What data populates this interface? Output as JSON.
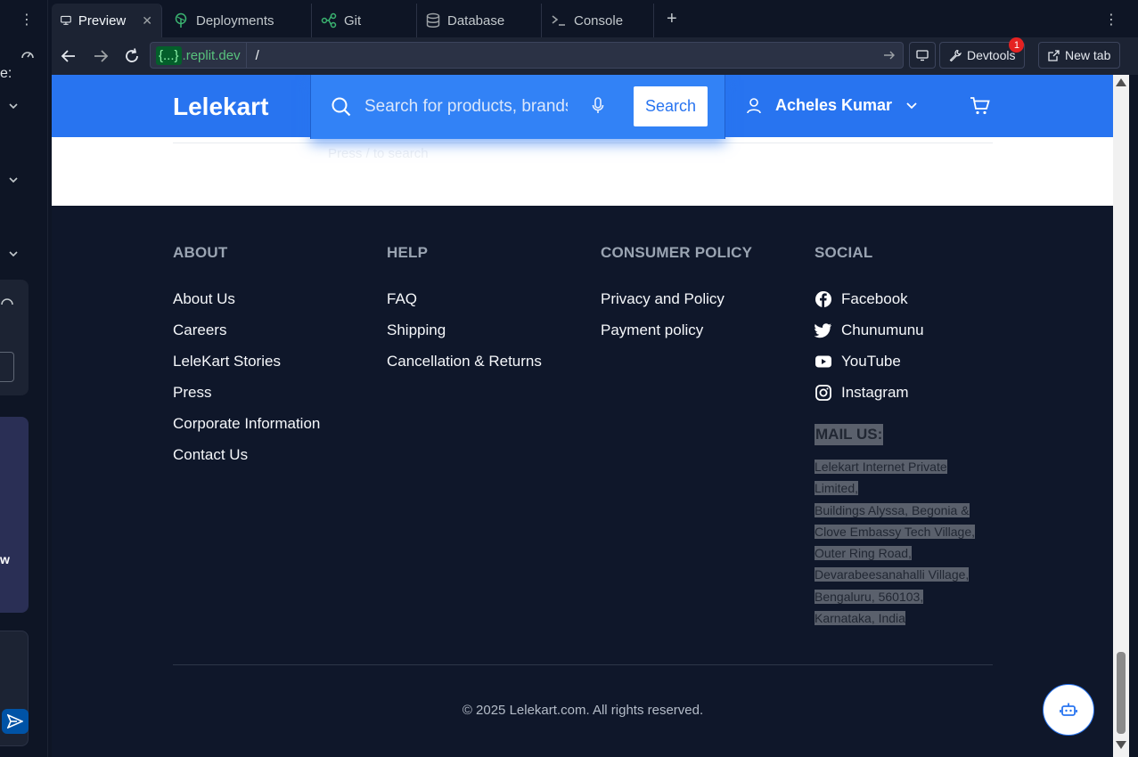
{
  "left_panel": {
    "colon_text": "e:",
    "partial_text": "w"
  },
  "tabs": [
    {
      "label": "Preview",
      "icon": "monitor-icon",
      "active": true
    },
    {
      "label": "Deployments",
      "icon": "deployments-icon"
    },
    {
      "label": "Git",
      "icon": "git-icon"
    },
    {
      "label": "Database",
      "icon": "database-icon"
    },
    {
      "label": "Console",
      "icon": "console-icon"
    }
  ],
  "address": {
    "host_pill": "{...}",
    "host_suffix": ".replit.dev",
    "path": "/",
    "devtools_label": "Devtools",
    "devtools_badge": "1",
    "new_tab_label": "New tab"
  },
  "site": {
    "logo": "Lelekart",
    "search_placeholder": "Search for products, brands and more",
    "search_button": "Search",
    "search_hint": "Press / to search",
    "user_name": "Acheles Kumar",
    "colors": {
      "brand": "#2874f0",
      "footer_bg": "#0f172a"
    }
  },
  "footer": {
    "about": {
      "title": "ABOUT",
      "links": [
        "About Us",
        "Careers",
        "LeleKart Stories",
        "Press",
        "Corporate Information",
        "Contact Us"
      ]
    },
    "help": {
      "title": "HELP",
      "links": [
        "FAQ",
        "Shipping",
        "Cancellation & Returns"
      ]
    },
    "policy": {
      "title": "CONSUMER POLICY",
      "links": [
        "Privacy and Policy",
        "Payment policy"
      ]
    },
    "social": {
      "title": "SOCIAL",
      "links": [
        "Facebook",
        "Chunumunu",
        "YouTube",
        "Instagram"
      ]
    },
    "mail": {
      "title": "MAIL US:",
      "lines": [
        "Lelekart Internet Private Limited,",
        "Buildings Alyssa, Begonia & Clove Embassy Tech Village,",
        "Outer Ring Road, Devarabeesanahalli Village,",
        "Bengaluru, 560103,",
        "Karnataka, India"
      ]
    },
    "copyright": "© 2025 Lelekart.com. All rights reserved."
  }
}
